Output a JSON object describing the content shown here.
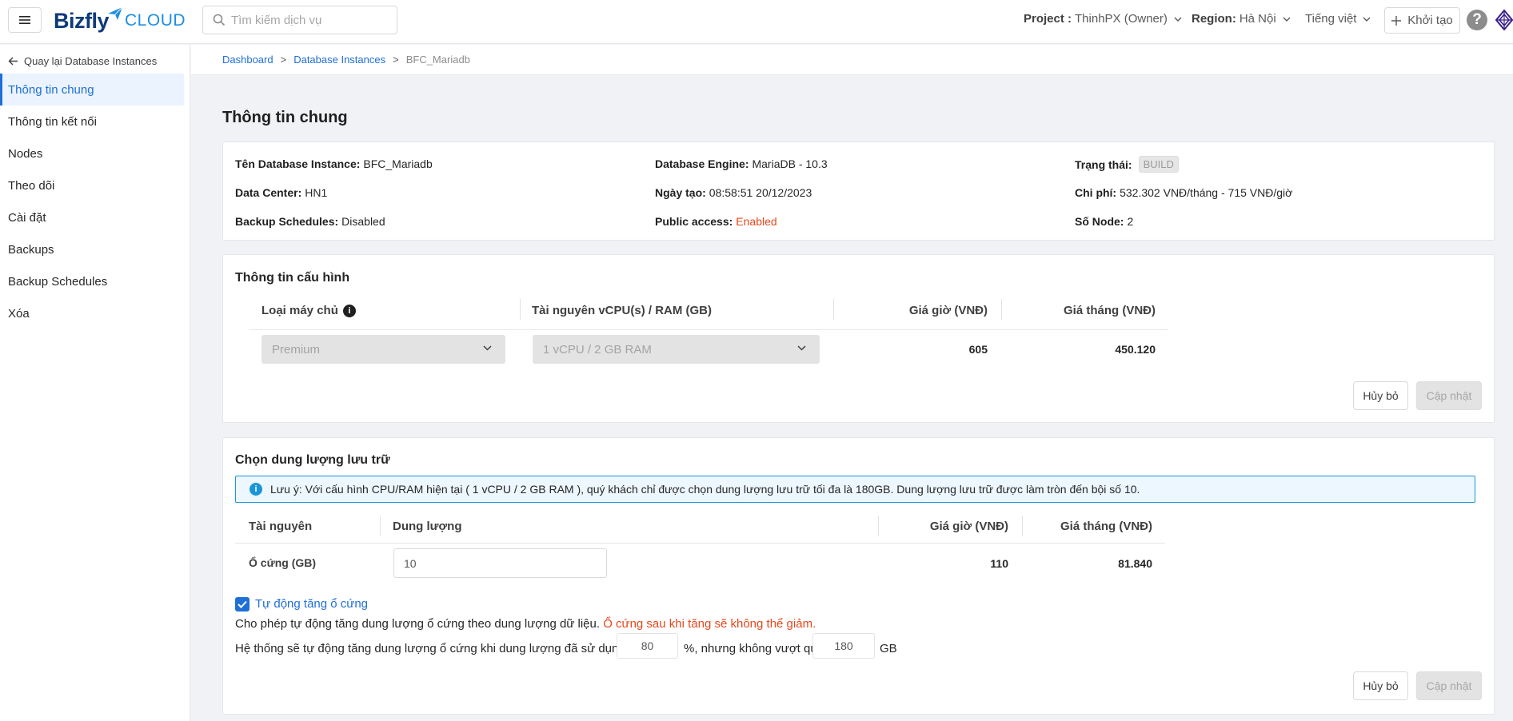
{
  "header": {
    "logo_main": "Bizfly",
    "logo_sub": "CLOUD",
    "search_placeholder": "Tìm kiếm dịch vụ",
    "project_label": "Project :",
    "project_value": "ThinhPX (Owner)",
    "region_label": "Region:",
    "region_value": "Hà Nội",
    "language": "Tiếng việt",
    "create_label": "Khởi tạo",
    "help_glyph": "?"
  },
  "sidebar": {
    "back_label": "Quay lại Database Instances",
    "items": [
      {
        "label": "Thông tin chung",
        "active": true
      },
      {
        "label": "Thông tin kết nối"
      },
      {
        "label": "Nodes"
      },
      {
        "label": "Theo dõi"
      },
      {
        "label": "Cài đặt"
      },
      {
        "label": "Backups"
      },
      {
        "label": "Backup Schedules"
      },
      {
        "label": "Xóa"
      }
    ]
  },
  "breadcrumb": {
    "items": [
      "Dashboard",
      "Database Instances",
      "BFC_Mariadb"
    ],
    "separator": ">"
  },
  "page_title": "Thông tin chung",
  "general_info": {
    "name_label": "Tên Database Instance:",
    "name_value": "BFC_Mariadb",
    "engine_label": "Database Engine:",
    "engine_value": "MariaDB - 10.3",
    "status_label": "Trạng thái:",
    "status_value": "BUILD",
    "dc_label": "Data Center:",
    "dc_value": "HN1",
    "created_label": "Ngày tạo:",
    "created_value": "08:58:51 20/12/2023",
    "cost_label": "Chi phí:",
    "cost_value": "532.302 VNĐ/tháng - 715 VNĐ/giờ",
    "backup_label": "Backup Schedules:",
    "backup_value": "Disabled",
    "public_label": "Public access:",
    "public_value": "Enabled",
    "nodes_label": "Số Node:",
    "nodes_value": "2"
  },
  "config": {
    "title": "Thông tin cấu hình",
    "col_machine": "Loại máy chủ",
    "col_resource": "Tài nguyên vCPU(s) / RAM (GB)",
    "col_hour": "Giá giờ (VNĐ)",
    "col_month": "Giá tháng (VNĐ)",
    "machine_value": "Premium",
    "resource_value": "1 vCPU / 2 GB RAM",
    "hour_price": "605",
    "month_price": "450.120",
    "cancel_label": "Hủy bỏ",
    "update_label": "Cập nhật"
  },
  "storage": {
    "title": "Chọn dung lượng lưu trữ",
    "notice": "Lưu ý: Với cấu hình CPU/RAM hiện tại ( 1 vCPU / 2 GB RAM ), quý khách chỉ được chọn dung lượng lưu trữ tối đa là 180GB. Dung lượng lưu trữ được làm tròn đến bội số 10.",
    "col_resource": "Tài nguyên",
    "col_capacity": "Dung lượng",
    "col_hour": "Giá giờ (VNĐ)",
    "col_month": "Giá tháng (VNĐ)",
    "row_label": "Ổ cứng (GB)",
    "capacity_value": "10",
    "hour_price": "110",
    "month_price": "81.840",
    "auto_label": "Tự động tăng ổ cứng",
    "auto_checked": true,
    "desc_prefix": "Cho phép tự động tăng dung lượng ổ cứng theo dung lượng dữ liệu.",
    "desc_warning": "Ổ cứng sau khi tăng sẽ không thể giảm.",
    "threshold_prefix": "Hệ thống sẽ tự động tăng dung lượng ổ cứng khi dung lượng đã sử dụng đạt",
    "threshold_value": "80",
    "threshold_mid": "%, nhưng không vượt quá",
    "max_value": "180",
    "max_unit": "GB",
    "cancel_label": "Hủy bỏ",
    "update_label": "Cập nhật"
  },
  "colors": {
    "primary": "#1f6fd6",
    "danger": "#e8471d",
    "brand_dark": "#0d3a7a",
    "brand_light": "#1c8fe6"
  }
}
